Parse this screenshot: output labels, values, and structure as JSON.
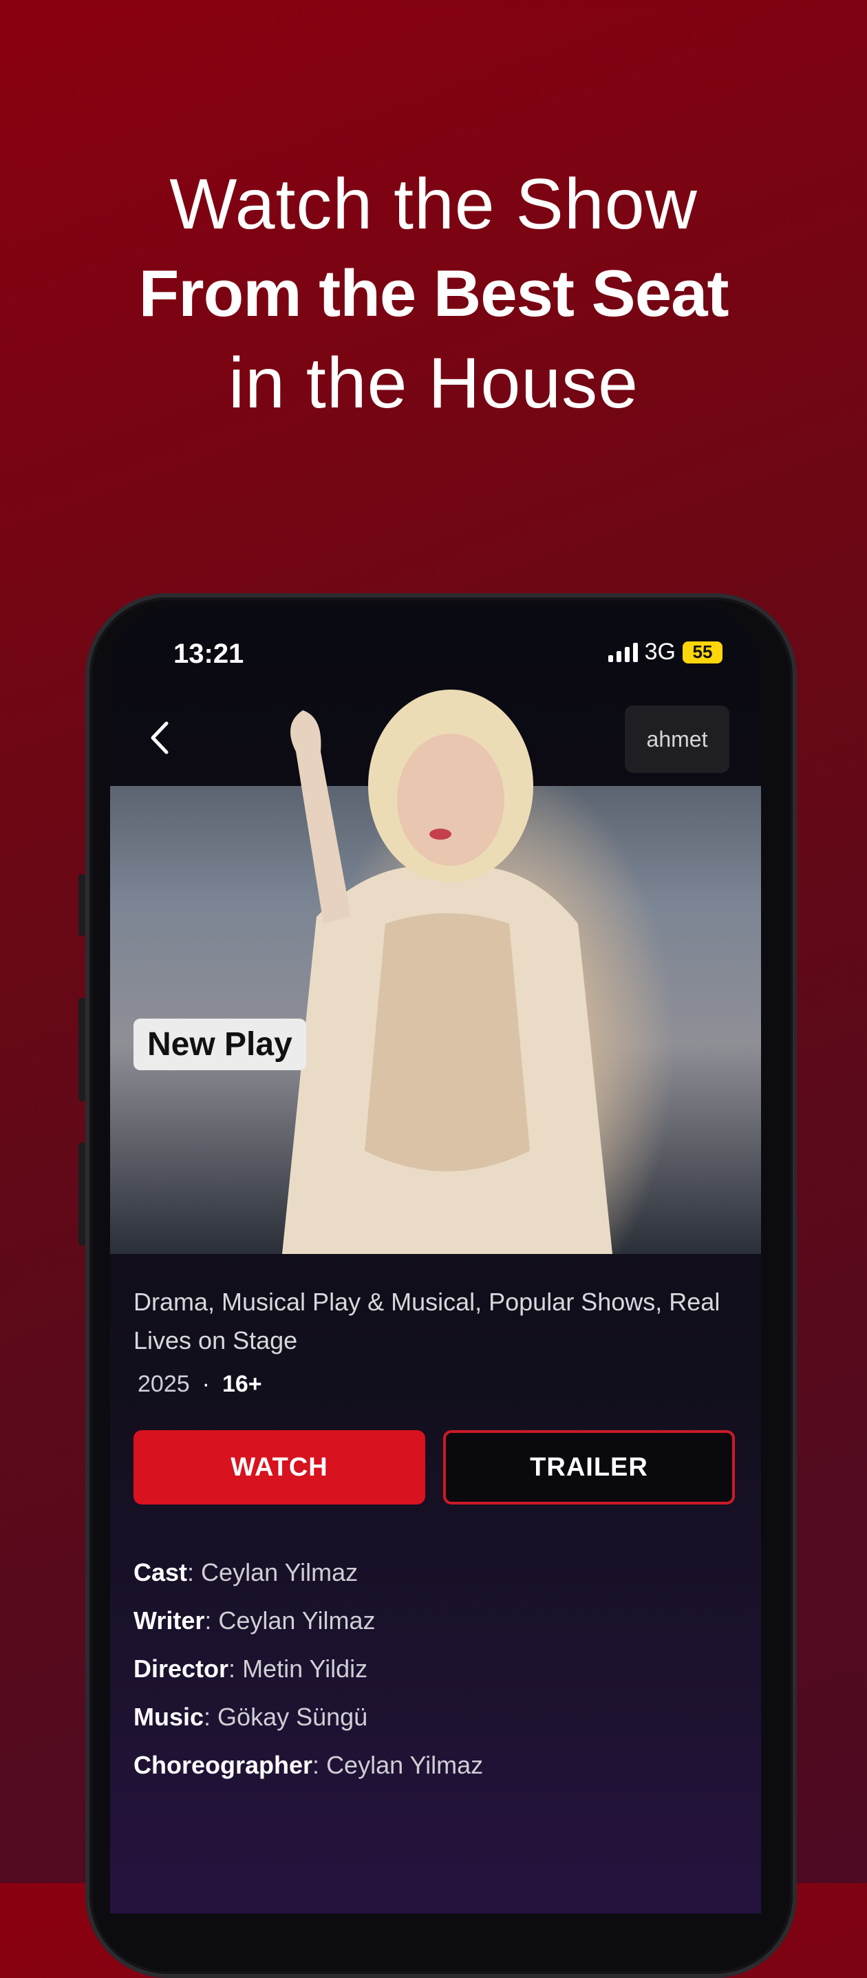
{
  "headline": {
    "line1": "Watch the Show",
    "line2": "From the Best Seat",
    "line3": "in the House"
  },
  "status_bar": {
    "time": "13:21",
    "network": "3G",
    "battery": "55"
  },
  "nav": {
    "back_icon": "chevron-left-icon",
    "profile_name": "ahmet"
  },
  "hero": {
    "badge": "New Play"
  },
  "details": {
    "genres": "Drama, Musical Play & Musical, Popular Shows, Real Lives on Stage",
    "year": "2025",
    "separator": "·",
    "age_rating": "16+"
  },
  "buttons": {
    "watch": "WATCH",
    "trailer": "TRAILER"
  },
  "credits": [
    {
      "role": "Cast",
      "name": "Ceylan Yilmaz"
    },
    {
      "role": "Writer",
      "name": "Ceylan Yilmaz"
    },
    {
      "role": "Director",
      "name": "Metin Yildiz"
    },
    {
      "role": "Music",
      "name": "Gökay Süngü"
    },
    {
      "role": "Choreographer",
      "name": "Ceylan Yilmaz"
    }
  ],
  "colors": {
    "accent_red": "#d8121f",
    "background_red": "#8a0010",
    "battery_yellow": "#ffd60a"
  }
}
